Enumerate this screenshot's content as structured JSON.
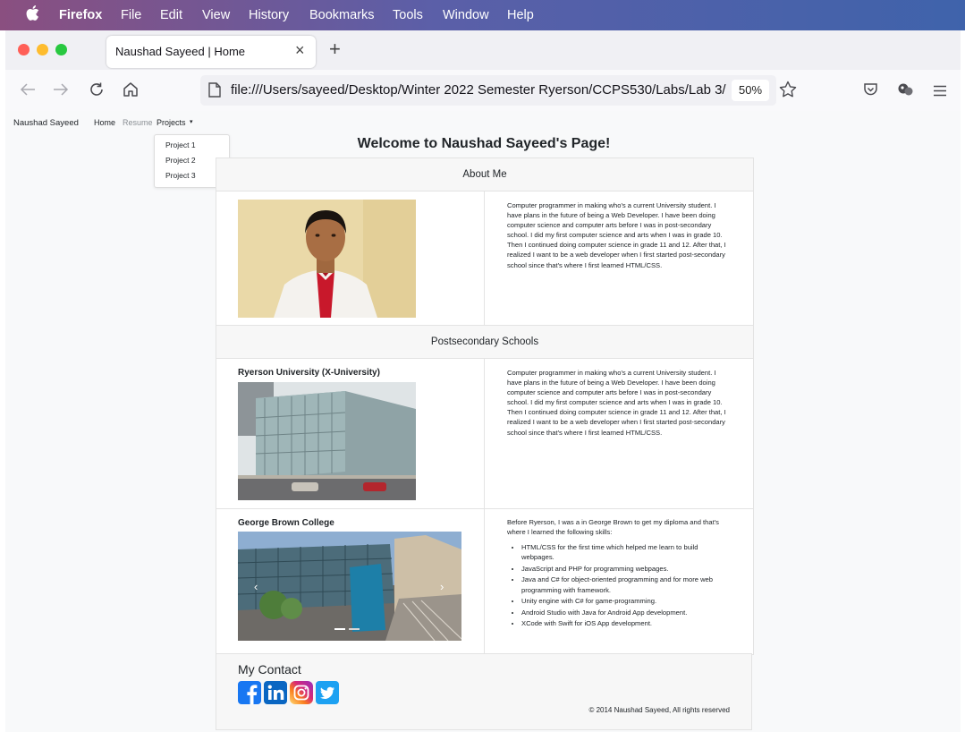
{
  "menubar": {
    "app": "Firefox",
    "items": [
      "File",
      "Edit",
      "View",
      "History",
      "Bookmarks",
      "Tools",
      "Window",
      "Help"
    ]
  },
  "tab": {
    "title": "Naushad Sayeed | Home",
    "close": "×",
    "new_tab": "+"
  },
  "toolbar": {
    "url": "file:///Users/sayeed/Desktop/Winter 2022 Semester Ryerson/CCPS530/Labs/Lab 3/",
    "zoom": "50%"
  },
  "site_nav": {
    "brand": "Naushad Sayeed",
    "links": [
      "Home",
      "Resume",
      "Projects"
    ],
    "dropdown": [
      "Project 1",
      "Project 2",
      "Project 3"
    ]
  },
  "page": {
    "title": "Welcome to Naushad Sayeed's Page!",
    "about": {
      "heading": "About Me",
      "text": "Computer programmer in making who's a current University student. I have plans in the future of being a Web Developer. I have been doing computer science and computer arts before I was in post-secondary school. I did my first computer science and arts when I was in grade 10. Then I continued doing computer science in grade 11 and 12. After that, I realized I want to be a web developer when I first started post-secondary school since that's where I first learned HTML/CSS."
    },
    "schools": {
      "heading": "Postsecondary Schools",
      "ryerson": {
        "name": "Ryerson University (X-University)",
        "text": "Computer programmer in making who's a current University student. I have plans in the future of being a Web Developer. I have been doing computer science and computer arts before I was in post-secondary school. I did my first computer science and arts when I was in grade 10. Then I continued doing computer science in grade 11 and 12. After that, I realized I want to be a web developer when I first started post-secondary school since that's where I first learned HTML/CSS."
      },
      "george_brown": {
        "name": "George Brown College",
        "intro": "Before Ryerson, I was a in George Brown to get my diploma and that's where I learned the following skills:",
        "skills": [
          "HTML/CSS for the first time which helped me learn to build webpages.",
          "JavaScript and PHP for programming webpages.",
          "Java and C# for object-oriented programming and for more web programming with framework.",
          "Unity engine with C# for game-programming.",
          "Android Studio with Java for Android App development.",
          "XCode with Swift for iOS App development."
        ]
      }
    },
    "contact": {
      "heading": "My Contact",
      "copyright": "© 2014 Naushad Sayeed, All rights reserved"
    }
  },
  "colors": {
    "menubar_start": "#8a4f80",
    "menubar_end": "#3f63ab",
    "facebook": "#1877f2",
    "linkedin": "#0a66c2",
    "twitter": "#1da1f2"
  }
}
